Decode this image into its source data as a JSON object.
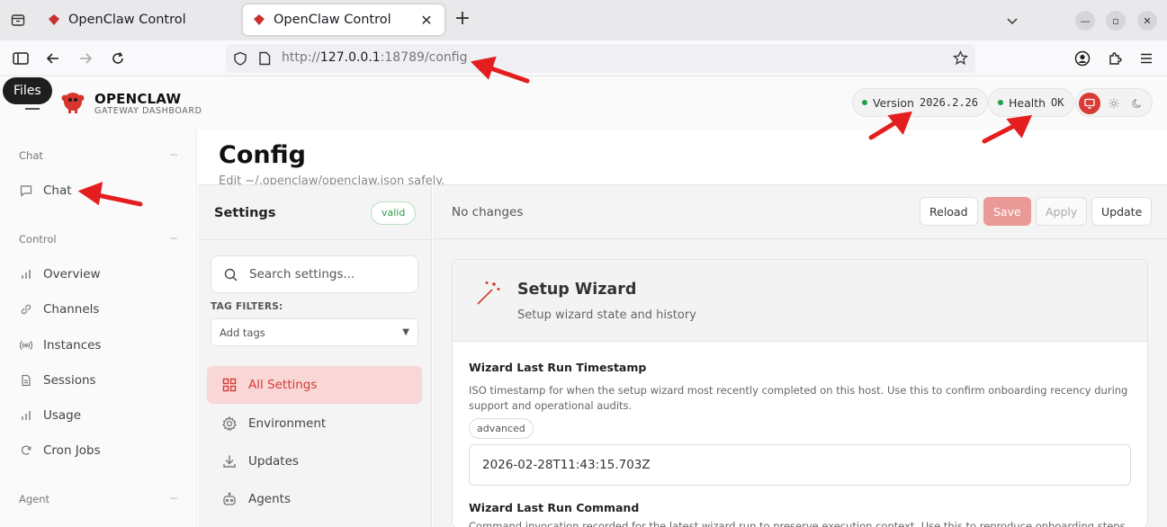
{
  "browser": {
    "tabs": [
      {
        "title": "OpenClaw Control",
        "active": false
      },
      {
        "title": "OpenClaw Control",
        "active": true
      }
    ],
    "url_scheme": "http://",
    "url_host": "127.0.0.1",
    "url_rest": ":18789/config",
    "tooltip": "Files"
  },
  "header": {
    "brand_title": "OPENCLAW",
    "brand_sub": "GATEWAY DASHBOARD",
    "version_label": "Version",
    "version_value": "2026.2.26",
    "health_label": "Health",
    "health_value": "OK",
    "status_color": "#22a046",
    "accent_color": "#d83a34",
    "theme_options": [
      "monitor-icon",
      "sun-icon",
      "moon-icon"
    ]
  },
  "sidebar": {
    "groups": [
      {
        "label": "Chat",
        "items": [
          {
            "label": "Chat",
            "icon": "chat-icon"
          }
        ]
      },
      {
        "label": "Control",
        "items": [
          {
            "label": "Overview",
            "icon": "bar-chart-icon"
          },
          {
            "label": "Channels",
            "icon": "link-icon"
          },
          {
            "label": "Instances",
            "icon": "broadcast-icon"
          },
          {
            "label": "Sessions",
            "icon": "document-icon"
          },
          {
            "label": "Usage",
            "icon": "bar-chart-icon"
          },
          {
            "label": "Cron Jobs",
            "icon": "loop-icon"
          }
        ]
      },
      {
        "label": "Agent",
        "items": []
      }
    ],
    "collapse_glyph": "−"
  },
  "page": {
    "title": "Config",
    "subtitle": "Edit ~/.openclaw/openclaw.json safely."
  },
  "settings": {
    "heading": "Settings",
    "badge": "valid",
    "search_placeholder": "Search settings...",
    "tag_filters_label": "TAG FILTERS:",
    "tag_placeholder": "Add tags",
    "categories": [
      {
        "label": "All Settings",
        "icon": "grid-icon",
        "active": true
      },
      {
        "label": "Environment",
        "icon": "gear-icon",
        "active": false
      },
      {
        "label": "Updates",
        "icon": "download-icon",
        "active": false
      },
      {
        "label": "Agents",
        "icon": "robot-icon",
        "active": false
      }
    ]
  },
  "toolbar": {
    "status": "No changes",
    "reload": "Reload",
    "save": "Save",
    "apply": "Apply",
    "update": "Update"
  },
  "section": {
    "title": "Setup Wizard",
    "subtitle": "Setup wizard state and history",
    "fields": [
      {
        "label": "Wizard Last Run Timestamp",
        "help": "ISO timestamp for when the setup wizard most recently completed on this host. Use this to confirm onboarding recency during support and operational audits.",
        "tag": "advanced",
        "value": "2026-02-28T11:43:15.703Z"
      },
      {
        "label": "Wizard Last Run Command",
        "help": "Command invocation recorded for the latest wizard run to preserve execution context. Use this to reproduce onboarding steps when"
      }
    ]
  }
}
